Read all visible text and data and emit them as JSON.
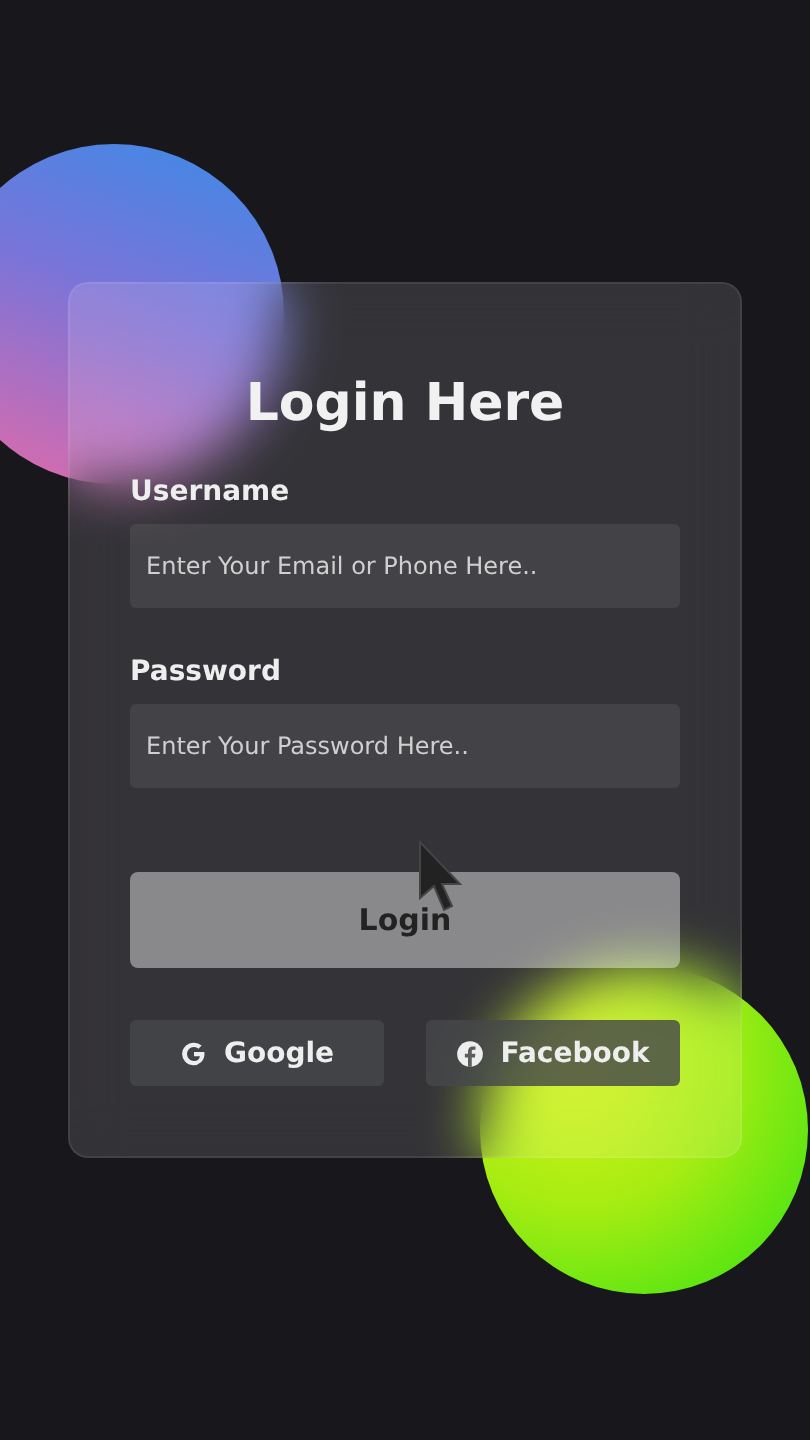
{
  "title": "Login Here",
  "fields": [
    {
      "label": "Username",
      "placeholder": "Enter Your Email or Phone Here.."
    },
    {
      "label": "Password",
      "placeholder": "Enter Your Password Here.."
    }
  ],
  "login_button": "Login",
  "social_buttons": [
    {
      "kind": "google",
      "label": "Google"
    },
    {
      "kind": "facebook",
      "label": "Facebook"
    }
  ]
}
